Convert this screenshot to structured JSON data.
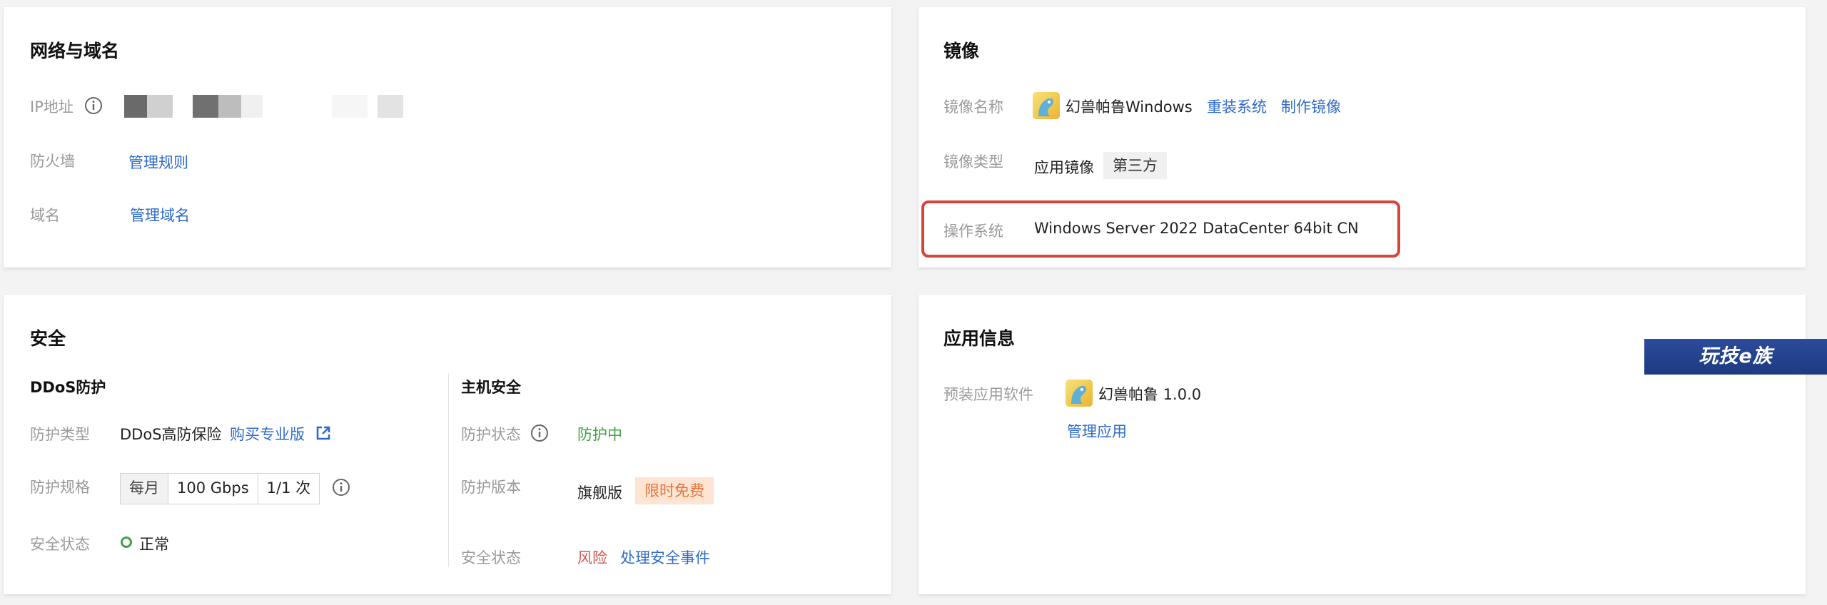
{
  "network": {
    "title": "网络与域名",
    "ip_label": "IP地址",
    "firewall_label": "防火墙",
    "firewall_link": "管理规则",
    "domain_label": "域名",
    "domain_link": "管理域名"
  },
  "image": {
    "title": "镜像",
    "name_label": "镜像名称",
    "name_value": "幻兽帕鲁Windows",
    "reinstall_link": "重装系统",
    "make_image_link": "制作镜像",
    "type_label": "镜像类型",
    "type_value": "应用镜像",
    "type_tag": "第三方",
    "os_label": "操作系统",
    "os_value": "Windows Server 2022 DataCenter 64bit CN"
  },
  "security": {
    "title": "安全",
    "ddos": {
      "title": "DDoS防护",
      "type_label": "防护类型",
      "type_value": "DDoS高防保险",
      "buy_link": "购买专业版",
      "spec_label": "防护规格",
      "spec_period": "每月",
      "spec_bandwidth": "100 Gbps",
      "spec_count": "1/1 次",
      "status_label": "安全状态",
      "status_value": "正常"
    },
    "host": {
      "title": "主机安全",
      "status_label": "防护状态",
      "status_value": "防护中",
      "version_label": "防护版本",
      "version_value": "旗舰版",
      "version_tag": "限时免费",
      "safety_label": "安全状态",
      "safety_value": "风险",
      "handle_link": "处理安全事件"
    }
  },
  "app_info": {
    "title": "应用信息",
    "software_label": "预装应用软件",
    "software_value": "幻兽帕鲁 1.0.0",
    "manage_link": "管理应用"
  },
  "watermark": {
    "text": "玩技e族"
  },
  "colors": {
    "link": "#2f6bcb",
    "ok": "#43a047",
    "risk": "#d9534f",
    "free_tag_bg": "#fde4d3",
    "free_tag_text": "#e8743b",
    "highlight": "#d6453a"
  },
  "icons": [
    "info-circle-icon",
    "external-link-icon",
    "status-ok-ring-icon",
    "palworld-app-icon"
  ]
}
